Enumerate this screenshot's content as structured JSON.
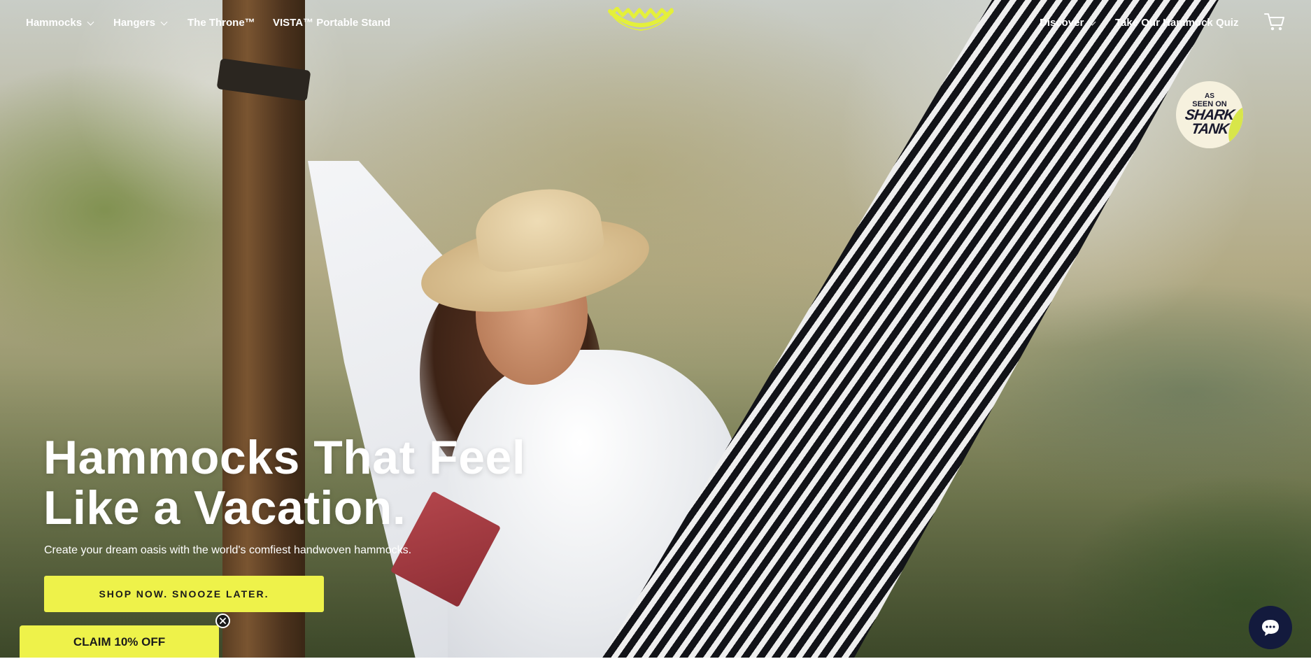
{
  "nav": {
    "left_items": [
      {
        "label": "Hammocks",
        "has_dropdown": true
      },
      {
        "label": "Hangers",
        "has_dropdown": true
      },
      {
        "label": "The Throne™",
        "has_dropdown": false
      },
      {
        "label": "VISTA™ Portable Stand",
        "has_dropdown": false
      }
    ],
    "right_items": [
      {
        "label": "Discover",
        "has_dropdown": true
      },
      {
        "label": "Take Our Hammock Quiz",
        "has_dropdown": false
      }
    ],
    "logo_icon": "hammock-logo-icon",
    "cart_icon": "cart-icon"
  },
  "badge": {
    "line1": "AS",
    "line2": "SEEN ON",
    "line3": "SHARK",
    "line4": "TANK"
  },
  "hero": {
    "headline_line1": "Hammocks That Feel",
    "headline_line2": "Like a Vacation.",
    "subhead": "Create your dream oasis with the world's comfiest handwoven hammocks.",
    "cta_label": "SHOP NOW. SNOOZE LATER."
  },
  "promo": {
    "claim_label": "CLAIM 10% OFF",
    "close_icon": "close-icon"
  },
  "chat": {
    "icon": "chat-icon"
  },
  "colors": {
    "accent_yellow": "#eef24a",
    "chat_navy": "#131a3d",
    "text_white": "#ffffff"
  }
}
